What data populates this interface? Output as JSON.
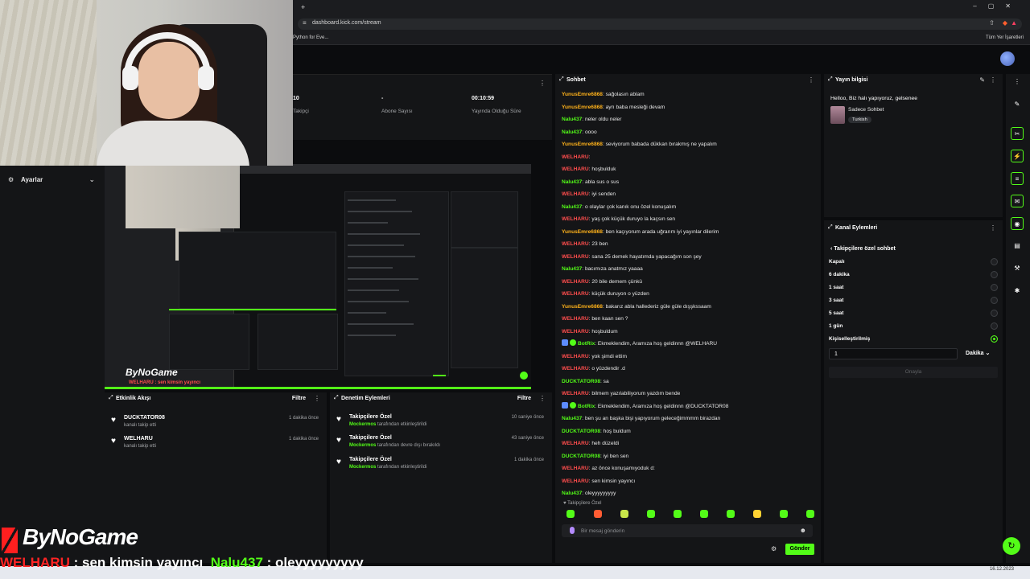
{
  "browser": {
    "url": "dashboard.kick.com/stream",
    "bookmark": "Python for Eve...",
    "bookmarks_all": "Tüm Yer İşaretleri"
  },
  "sidebar": {
    "settings_label": "Ayarlar"
  },
  "stats": [
    {
      "value": "10",
      "label": "Takipçi"
    },
    {
      "value": "-",
      "label": "Abone Sayısı"
    },
    {
      "value": "00:10:59",
      "label": "Yayında Olduğu Süre"
    }
  ],
  "preview": {
    "logo": "ByNoGame",
    "ticker": "WELHARU : sen kimsin yayıncı"
  },
  "activity": {
    "title": "Etkinlik Akışı",
    "filter": "Filtre",
    "items": [
      {
        "name": "DUCKTATOR08",
        "desc": "kanalı takip etti",
        "time": "1 dakika önce"
      },
      {
        "name": "WELHARU",
        "desc": "kanalı takip etti",
        "time": "1 dakika önce"
      }
    ]
  },
  "moderation": {
    "title": "Denetim Eylemleri",
    "filter": "Filtre",
    "items": [
      {
        "name": "Takipçilere Özel",
        "mod": "Mockermos",
        "desc": "tarafından etkinleştirildi",
        "time": "10 saniye önce"
      },
      {
        "name": "Takipçilere Özel",
        "mod": "Mockermos",
        "desc": "tarafından devre dışı bırakıldı",
        "time": "43 saniye önce"
      },
      {
        "name": "Takipçilere Özel",
        "mod": "Mockermos",
        "desc": "tarafından etkinleştirildi",
        "time": "1 dakika önce"
      }
    ]
  },
  "chat": {
    "title": "Sohbet",
    "messages": [
      {
        "user": "YunusEmre6868",
        "color": "#ffb21a",
        "text": "sağolasın ablam"
      },
      {
        "user": "YunusEmre6868",
        "color": "#ffb21a",
        "text": "ayrı baba mesleği devam"
      },
      {
        "user": "Nalu437",
        "color": "#53fc18",
        "text": "neler oldu neler"
      },
      {
        "user": "Nalu437",
        "color": "#53fc18",
        "text": "oooo"
      },
      {
        "user": "YunusEmre6868",
        "color": "#ffb21a",
        "text": "seviyorum babada dükkan bırakmış ne yapalım"
      },
      {
        "user": "WELHARU",
        "color": "#ff4d4d",
        "text": ""
      },
      {
        "user": "WELHARU",
        "color": "#ff4d4d",
        "text": "hoşbulduk"
      },
      {
        "user": "Nalu437",
        "color": "#53fc18",
        "text": "abla sus o sus"
      },
      {
        "user": "WELHARU",
        "color": "#ff4d4d",
        "text": "iyi senden"
      },
      {
        "user": "Nalu437",
        "color": "#53fc18",
        "text": "o olaylar çok kanık onu özel konuşalım"
      },
      {
        "user": "WELHARU",
        "color": "#ff4d4d",
        "text": "yaş çok küçük duruyo la kaçsın sen"
      },
      {
        "user": "YunusEmre6868",
        "color": "#ffb21a",
        "text": "ben kaçıyorum arada uğrarım iyi yayınlar dilerim"
      },
      {
        "user": "WELHARU",
        "color": "#ff4d4d",
        "text": "23 ben"
      },
      {
        "user": "WELHARU",
        "color": "#ff4d4d",
        "text": "sana 25 demek hayatımda yapacağım son şey"
      },
      {
        "user": "Nalu437",
        "color": "#53fc18",
        "text": "bacımıza anatmız yaaaa"
      },
      {
        "user": "WELHARU",
        "color": "#ff4d4d",
        "text": "20 bile demem çünkü"
      },
      {
        "user": "WELHARU",
        "color": "#ff4d4d",
        "text": "küçük duruyon o yüzden"
      },
      {
        "user": "YunusEmre6868",
        "color": "#ffb21a",
        "text": "bakarız abla hallederiz güle güle dışşkssaam"
      },
      {
        "user": "WELHARU",
        "color": "#ff4d4d",
        "text": "ben kaan sen ?"
      },
      {
        "user": "WELHARU",
        "color": "#ff4d4d",
        "text": "hoşbuldum"
      },
      {
        "user": "BotRix",
        "color": "#53fc18",
        "text": "Ekmeklendim, Aramıza hoş geldinnn @WELHARU",
        "bot": true
      },
      {
        "user": "WELHARU",
        "color": "#ff4d4d",
        "text": "yok şimdi ettim"
      },
      {
        "user": "WELHARU",
        "color": "#ff4d4d",
        "text": "o yüzdendir .d"
      },
      {
        "user": "DUCKTATOR08",
        "color": "#53fc18",
        "text": "sa"
      },
      {
        "user": "WELHARU",
        "color": "#ff4d4d",
        "text": "bilmem yazılabiliyorum yazdım bende"
      },
      {
        "user": "BotRix",
        "color": "#53fc18",
        "text": "Ekmeklendim, Aramıza hoş geldinnn @DUCKTATOR08",
        "bot": true
      },
      {
        "user": "Nalu437",
        "color": "#53fc18",
        "text": "ben şu an başka bişi yapıyorum geleceğimmmm birazdan"
      },
      {
        "user": "DUCKTATOR08",
        "color": "#53fc18",
        "text": "hoş buldum"
      },
      {
        "user": "WELHARU",
        "color": "#ff4d4d",
        "text": "heh düzeldi"
      },
      {
        "user": "DUCKTATOR08",
        "color": "#53fc18",
        "text": "iyi ben sen"
      },
      {
        "user": "WELHARU",
        "color": "#ff4d4d",
        "text": "az önce konuşamıyoduk d:"
      },
      {
        "user": "WELHARU",
        "color": "#ff4d4d",
        "text": "sen kimsin yayıncı"
      },
      {
        "user": "Nalu437",
        "color": "#53fc18",
        "text": "oleyyyyyyyyy"
      }
    ],
    "mode_text": "Takipçilere Özel",
    "input_placeholder": "Bir mesaj gönderin",
    "send_label": "Gönder"
  },
  "stream_info": {
    "title_label": "Yayın bilgisi",
    "stream_title": "Helloo, Biz halı yapıyoruz, gelsenee",
    "category": "Sadece Sohbet",
    "language": "Turkish"
  },
  "channel_actions": {
    "title": "Kanal Eylemleri",
    "back_label": "Takipçilere özel sohbet",
    "options": [
      "Kapalı",
      "6 dakika",
      "1 saat",
      "3 saat",
      "5 saat",
      "1 gün",
      "Kişiselleştirilmiş"
    ],
    "selected_index": 6,
    "custom_value": "1",
    "unit": "Dakika",
    "confirm_label": "Onayla"
  },
  "overlay": {
    "brand": "ByNoGame",
    "ticker_user1": "WELHARU",
    "ticker_msg1": " : sen kimsin yayıncı",
    "ticker_user2": "Nalu437",
    "ticker_msg2": " : oleyyyyyyyyy"
  },
  "taskbar": {
    "date": "16.12.2023"
  }
}
